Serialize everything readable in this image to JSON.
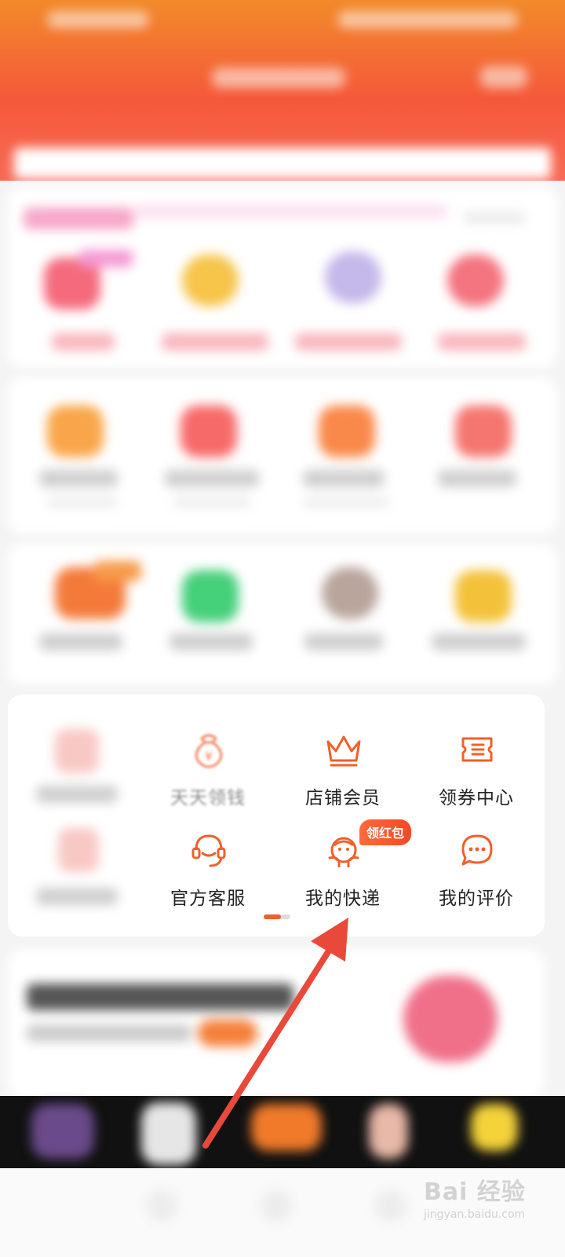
{
  "services": {
    "items": [
      {
        "label": "天天领钱",
        "icon": "money-bag-icon"
      },
      {
        "label": "店铺会员",
        "icon": "crown-icon"
      },
      {
        "label": "领券中心",
        "icon": "coupon-icon"
      },
      {
        "label": "官方客服",
        "icon": "headset-icon"
      },
      {
        "label": "我的快递",
        "icon": "delivery-mascot-icon",
        "badge": "领红包"
      },
      {
        "label": "我的评价",
        "icon": "chat-bubble-icon"
      }
    ],
    "page_indicator": {
      "current": 1,
      "total": 2
    }
  },
  "colors": {
    "accent": "#f0602a",
    "header_top": "#f28a2a",
    "header_bottom": "#f5583a",
    "annotation_arrow": "#e8493a"
  },
  "watermark": {
    "main": "Bai 经验",
    "sub": "jingyan.baidu.com"
  }
}
